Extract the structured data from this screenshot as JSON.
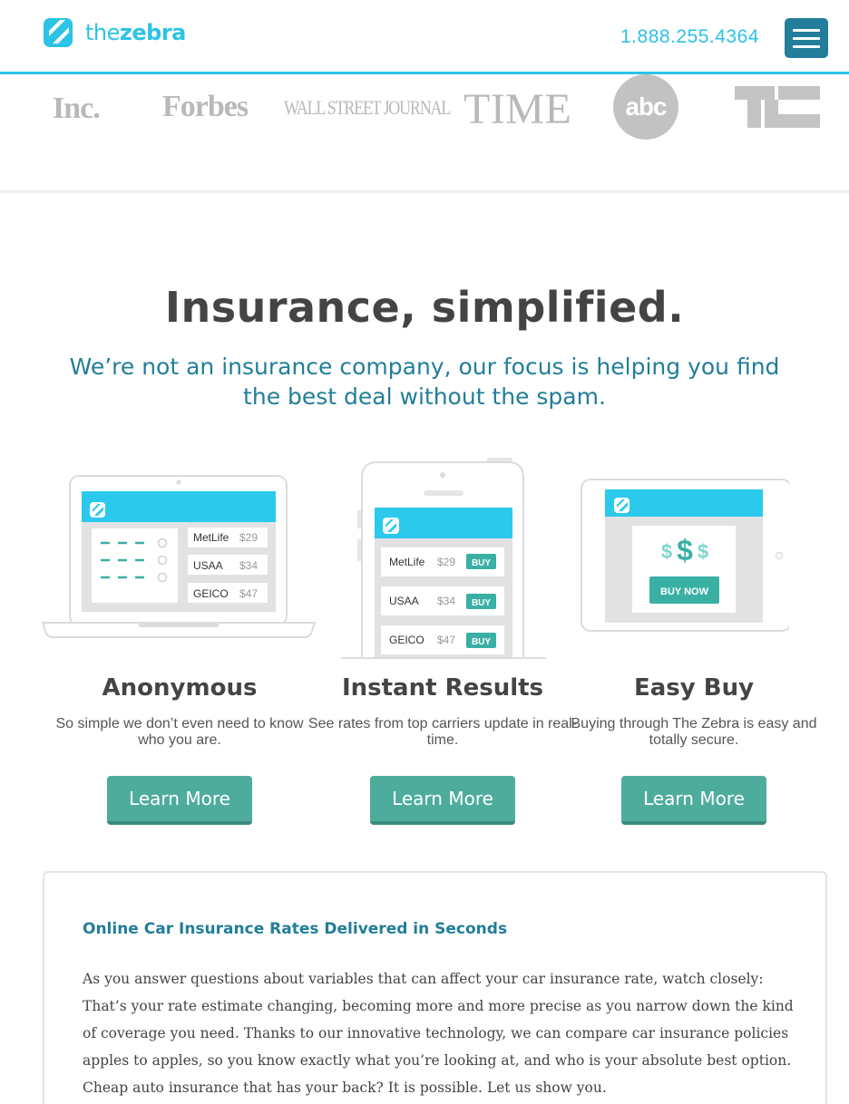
{
  "header": {
    "logo_the": "the",
    "logo_zebra": "zebra",
    "phone": "1.888.255.4364",
    "menu_icon": "hamburger-menu-icon",
    "accent_color": "#2bc3e6",
    "dark_accent_color": "#227e9a"
  },
  "press": {
    "logos": [
      "Inc.",
      "Forbes",
      "WALL STREET JOURNAL",
      "TIME",
      "abc",
      "TC"
    ]
  },
  "hero": {
    "title": "Insurance, simplified.",
    "subtitle": "We’re not an insurance company, our focus is helping you find the best deal without the spam."
  },
  "features": [
    {
      "title": "Anonymous",
      "description": "So simple we don’t even need to know who you are.",
      "button": "Learn More",
      "carriers": [
        {
          "name": "MetLife",
          "price": "$29"
        },
        {
          "name": "USAA",
          "price": "$34"
        },
        {
          "name": "GEICO",
          "price": "$47"
        }
      ]
    },
    {
      "title": "Instant Results",
      "description": "See rates from top carriers update in real-time.",
      "button": "Learn More",
      "buy_label": "BUY",
      "carriers": [
        {
          "name": "MetLife",
          "price": "$29"
        },
        {
          "name": "USAA",
          "price": "$34"
        },
        {
          "name": "GEICO",
          "price": "$47"
        }
      ]
    },
    {
      "title": "Easy Buy",
      "description": "Buying through The Zebra is easy and totally secure.",
      "button": "Learn More",
      "buy_now_label": "BUY NOW",
      "dollar_signs": [
        "$",
        "$",
        "$"
      ]
    }
  ],
  "info": {
    "title": "Online Car Insurance Rates Delivered in Seconds",
    "body": "As you answer questions about variables that can affect your car insurance rate, watch closely: That’s your rate estimate changing, becoming more and more precise as you narrow down the kind of coverage you need. Thanks to our innovative technology, we can compare car insurance policies apples to apples, so you know exactly what you’re looking at, and who is your absolute best option. Cheap auto insurance that has your back? It is possible. Let us show you."
  }
}
